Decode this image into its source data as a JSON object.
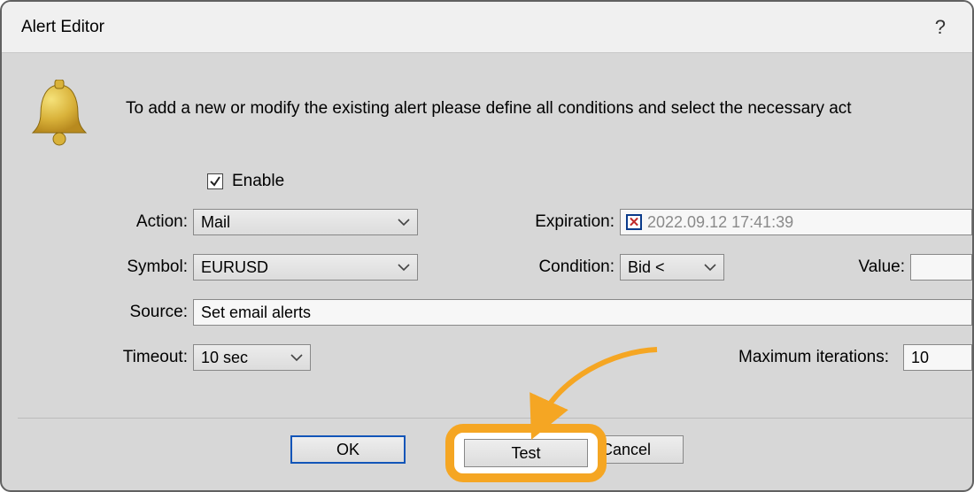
{
  "title": "Alert Editor",
  "help_icon": "?",
  "description": "To add a new or modify the existing alert please define all conditions and select the necessary act",
  "enable": {
    "label": "Enable",
    "checked": true
  },
  "labels": {
    "action": "Action:",
    "symbol": "Symbol:",
    "source": "Source:",
    "timeout": "Timeout:",
    "expiration": "Expiration:",
    "condition": "Condition:",
    "value": "Value:",
    "max_iter": "Maximum iterations:"
  },
  "fields": {
    "action": "Mail",
    "symbol": "EURUSD",
    "source": "Set email alerts",
    "timeout": "10 sec",
    "expiration": "2022.09.12 17:41:39",
    "expiration_enabled": false,
    "condition": "Bid <",
    "value": "",
    "max_iter": "10"
  },
  "buttons": {
    "ok": "OK",
    "test": "Test",
    "cancel": "Cancel"
  }
}
